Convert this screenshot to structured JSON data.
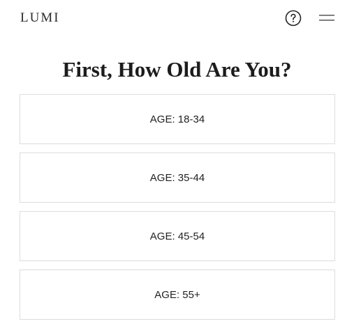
{
  "header": {
    "logo": "LUMI",
    "help_icon": "question-circle-icon",
    "menu_icon": "hamburger-menu-icon"
  },
  "main": {
    "title": "First, How Old Are You?",
    "options": [
      {
        "label": "AGE: 18-34"
      },
      {
        "label": "AGE: 35-44"
      },
      {
        "label": "AGE: 45-54"
      },
      {
        "label": "AGE: 55+"
      }
    ]
  },
  "colors": {
    "text": "#1c1c1c",
    "border": "#dcdcdc",
    "background": "#ffffff"
  }
}
